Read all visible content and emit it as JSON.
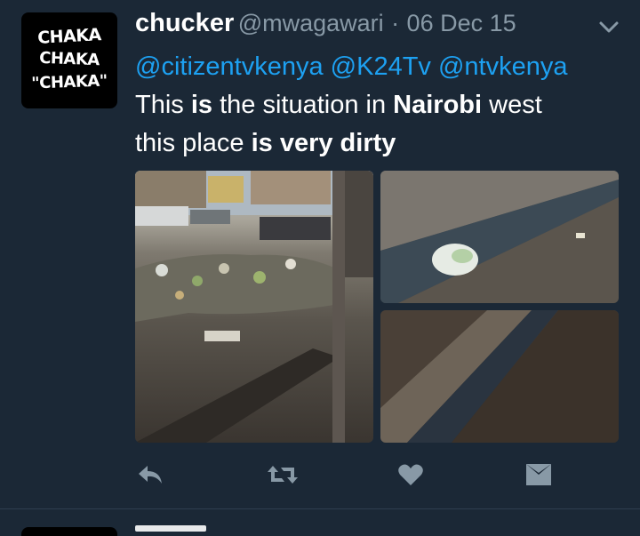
{
  "tweet": {
    "avatar_text": [
      "CHAKA",
      "CHAKA",
      "\"CHAKA\""
    ],
    "name": "chucker",
    "handle": "@mwagawari",
    "separator": "·",
    "date": "06 Dec 15",
    "mentions": [
      "@citizentvkenya",
      "@K24Tv",
      "@ntvkenya"
    ],
    "text": {
      "line1_a": "This ",
      "line1_b": "is",
      "line1_c": " the situation in ",
      "line1_d": "Nairobi",
      "line1_e": " west",
      "line2_a": "this place ",
      "line2_b": "is very dirty"
    },
    "media": [
      {
        "desc_icon": "garbage-street-photo"
      },
      {
        "desc_icon": "drain-plastic-bag-photo"
      },
      {
        "desc_icon": "drain-ditch-photo"
      }
    ]
  },
  "actions": {
    "reply_icon": "reply-icon",
    "retweet_icon": "retweet-icon",
    "like_icon": "heart-icon",
    "dm_icon": "envelope-icon"
  },
  "colors": {
    "background": "#1b2836",
    "mention": "#1da1f2",
    "muted": "#8899a6",
    "icon": "#8899a6"
  }
}
